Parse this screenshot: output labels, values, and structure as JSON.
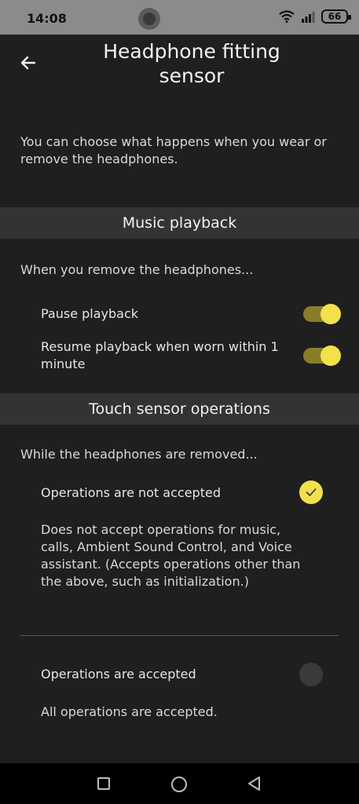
{
  "status_bar": {
    "time": "14:08",
    "battery": "66"
  },
  "header": {
    "title": "Headphone fitting sensor"
  },
  "intro": "You can choose what happens when you wear or remove the headphones.",
  "music_section": {
    "title": "Music playback",
    "subheading": "When you remove the headphones...",
    "pause_label": "Pause playback",
    "pause_on": true,
    "resume_label": "Resume playback when worn within 1 minute",
    "resume_on": true
  },
  "touch_section": {
    "title": "Touch sensor operations",
    "subheading": "While the headphones are removed...",
    "option1_label": "Operations are not accepted",
    "option1_desc": "Does not accept operations for music, calls, Ambient Sound Control, and Voice assistant. (Accepts operations other than the above, such as initialization.)",
    "option1_selected": true,
    "option2_label": "Operations are accepted",
    "option2_desc": "All operations are accepted.",
    "option2_selected": false
  },
  "colors": {
    "accent": "#f2e04c",
    "toggle_track": "#8a7d2a",
    "background": "#1f1f1f",
    "section_bg": "#333333"
  },
  "icons": {
    "back": "arrow-left-icon",
    "check": "check-icon",
    "wifi": "wifi-icon",
    "signal": "signal-icon"
  }
}
